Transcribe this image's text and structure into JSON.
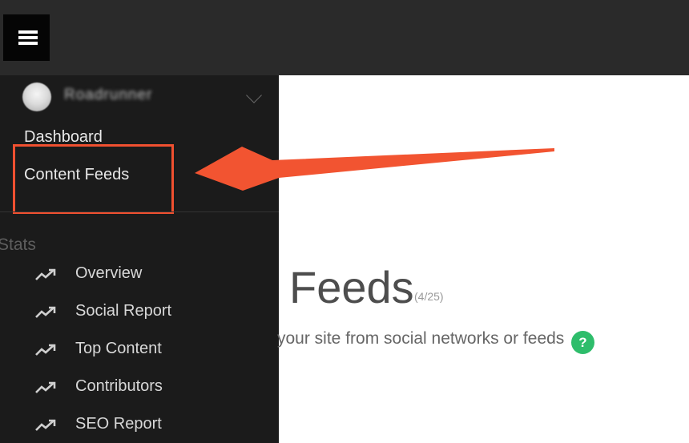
{
  "sidebar": {
    "username": "Roadrunner",
    "nav": {
      "dashboard": "Dashboard",
      "content_feeds": "Content Feeds"
    },
    "stats_title": "Stats",
    "stats_items": [
      {
        "label": "Overview",
        "icon": "trending-up-icon"
      },
      {
        "label": "Social Report",
        "icon": "trending-up-icon"
      },
      {
        "label": "Top Content",
        "icon": "trending-up-icon"
      },
      {
        "label": "Contributors",
        "icon": "trending-up-icon"
      },
      {
        "label": "SEO Report",
        "icon": "trending-up-icon"
      }
    ]
  },
  "main": {
    "title": "Feeds",
    "count": "(4/25)",
    "description": "your site from social networks or feeds",
    "help_icon": "?"
  },
  "colors": {
    "topbar": "#2a2a2a",
    "sidebar": "#1b1b1b",
    "highlight": "#f05030",
    "help": "#2ebd6b"
  }
}
